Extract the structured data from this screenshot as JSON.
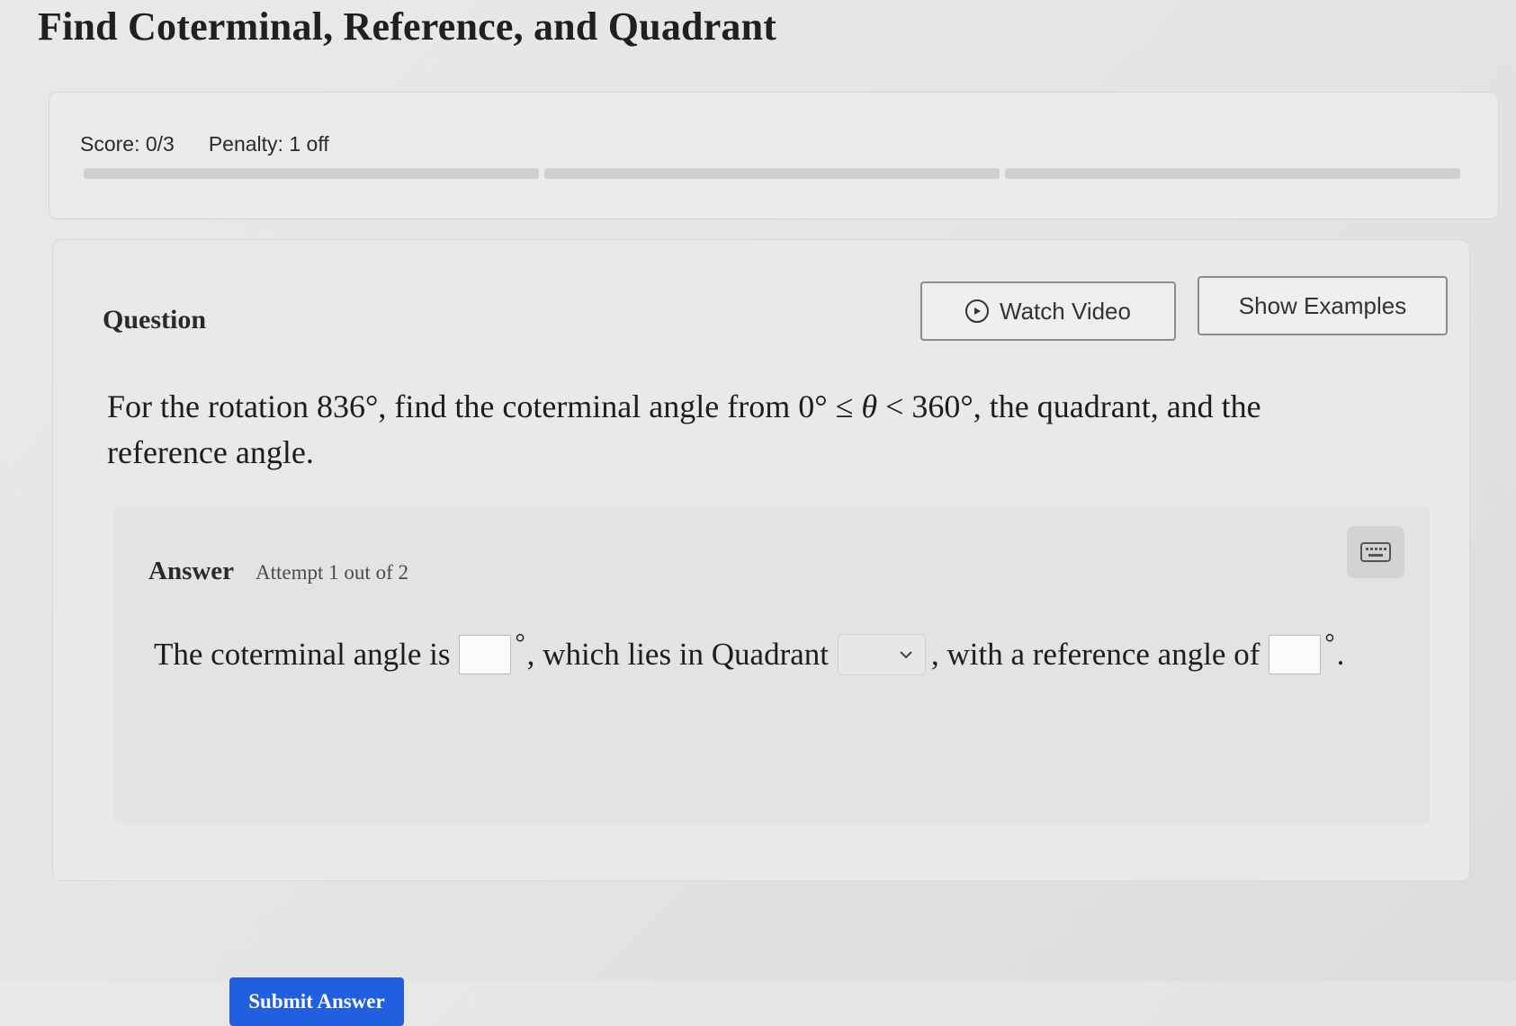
{
  "page": {
    "title": "Find Coterminal, Reference, and Quadrant"
  },
  "score": {
    "score_text": "Score: 0/3",
    "penalty_text": "Penalty: 1 off",
    "segments": 3
  },
  "question": {
    "label": "Question",
    "watch_video_label": "Watch Video",
    "show_examples_label": "Show Examples",
    "prompt_part1": "For the rotation ",
    "rotation": "836°",
    "prompt_part2": ", find the coterminal angle from ",
    "range_low": "0° ≤ ",
    "theta": "θ",
    "range_high": " < 360°",
    "prompt_part3": ", the quadrant, and the reference angle."
  },
  "answer": {
    "label": "Answer",
    "attempt": "Attempt 1 out of 2",
    "text1": "The coterminal angle is",
    "coterminal_value": "",
    "degree_symbol": "°",
    "text2": ", which lies in Quadrant",
    "quadrant_selected": "",
    "text3": ", with a reference angle of",
    "reference_value": "",
    "text_end": "."
  },
  "submit": {
    "label": "Submit Answer"
  },
  "icons": {
    "play": "play-circle-icon",
    "keyboard": "keyboard-icon",
    "dropdown": "chevron-down-icon"
  },
  "colors": {
    "submit_bg": "#1f5fe0",
    "submit_text": "#ffffff"
  }
}
